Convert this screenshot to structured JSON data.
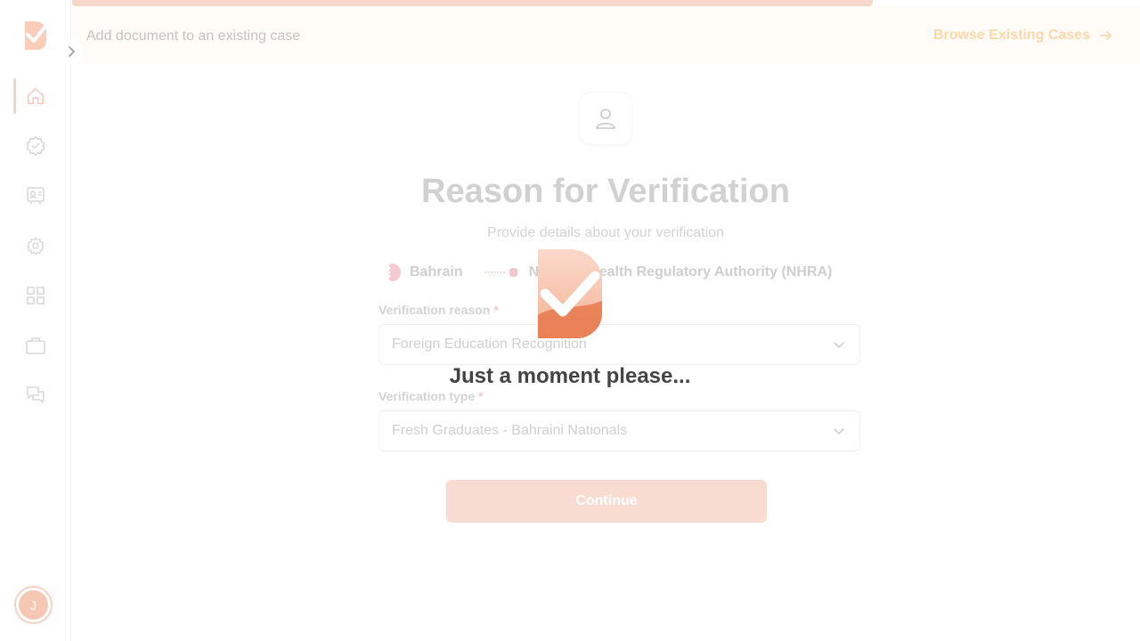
{
  "topbar": {
    "description": "Add document to an existing case",
    "browse_label": "Browse Existing Cases"
  },
  "sidebar": {
    "items": [
      {
        "icon": "home-icon",
        "active": true
      },
      {
        "icon": "verified-badge-icon",
        "active": false
      },
      {
        "icon": "id-card-icon",
        "active": false
      },
      {
        "icon": "gear-icon",
        "active": false
      },
      {
        "icon": "grid-icon",
        "active": false
      },
      {
        "icon": "briefcase-icon",
        "active": false
      },
      {
        "icon": "chat-icon",
        "active": false
      }
    ],
    "avatar_initial": "J"
  },
  "main": {
    "title": "Reason for Verification",
    "subtitle": "Provide details about your verification",
    "country": "Bahrain",
    "authority": "National Health Regulatory Authority (NHRA)",
    "reason_label": "Verification reason",
    "reason_value": "Foreign Education Recognition",
    "type_label": "Verification type",
    "type_value": "Fresh Graduates - Bahraini Nationals",
    "required_mark": "*",
    "continue_label": "Continue"
  },
  "loading": {
    "message": "Just a moment please..."
  },
  "colors": {
    "brand": "#e8794e",
    "brand_light": "#f8dbd1",
    "accent_link": "#fbd7a9"
  }
}
